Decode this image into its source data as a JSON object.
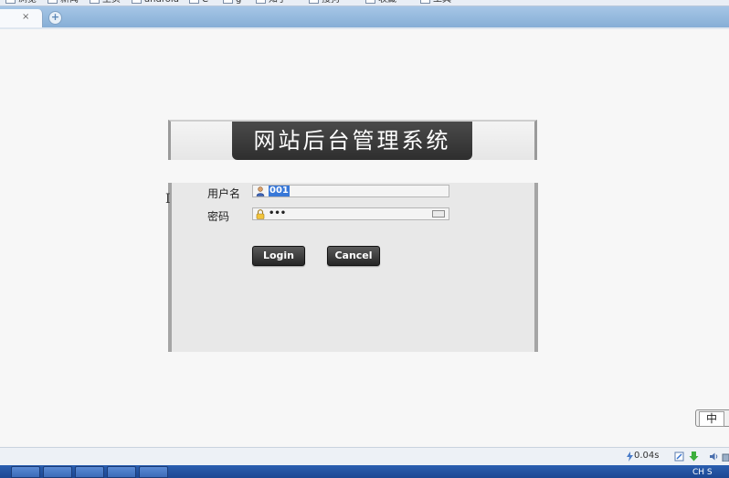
{
  "bookmarks": [
    {
      "label": "浏览"
    },
    {
      "label": "新闻"
    },
    {
      "label": "主页"
    },
    {
      "label": "android"
    },
    {
      "label": "C"
    },
    {
      "label": "g"
    },
    {
      "label": "知乎"
    },
    {
      "label": "搜狗"
    },
    {
      "label": "收藏"
    },
    {
      "label": "工具"
    }
  ],
  "tab": {
    "close_label": "×",
    "new_label": "+"
  },
  "login": {
    "title": "网站后台管理系统",
    "username_label": "用户名",
    "username_value": "001",
    "password_label": "密码",
    "password_value": "•••",
    "login_button": "Login",
    "cancel_button": "Cancel"
  },
  "ime": {
    "mode": "中"
  },
  "status": {
    "load_time": "0.04s"
  },
  "taskbar": {
    "tray_text": "CH S"
  },
  "colors": {
    "title_bg": "#333333",
    "panel_bg": "#e8e8e8",
    "selection": "#3878d8"
  }
}
